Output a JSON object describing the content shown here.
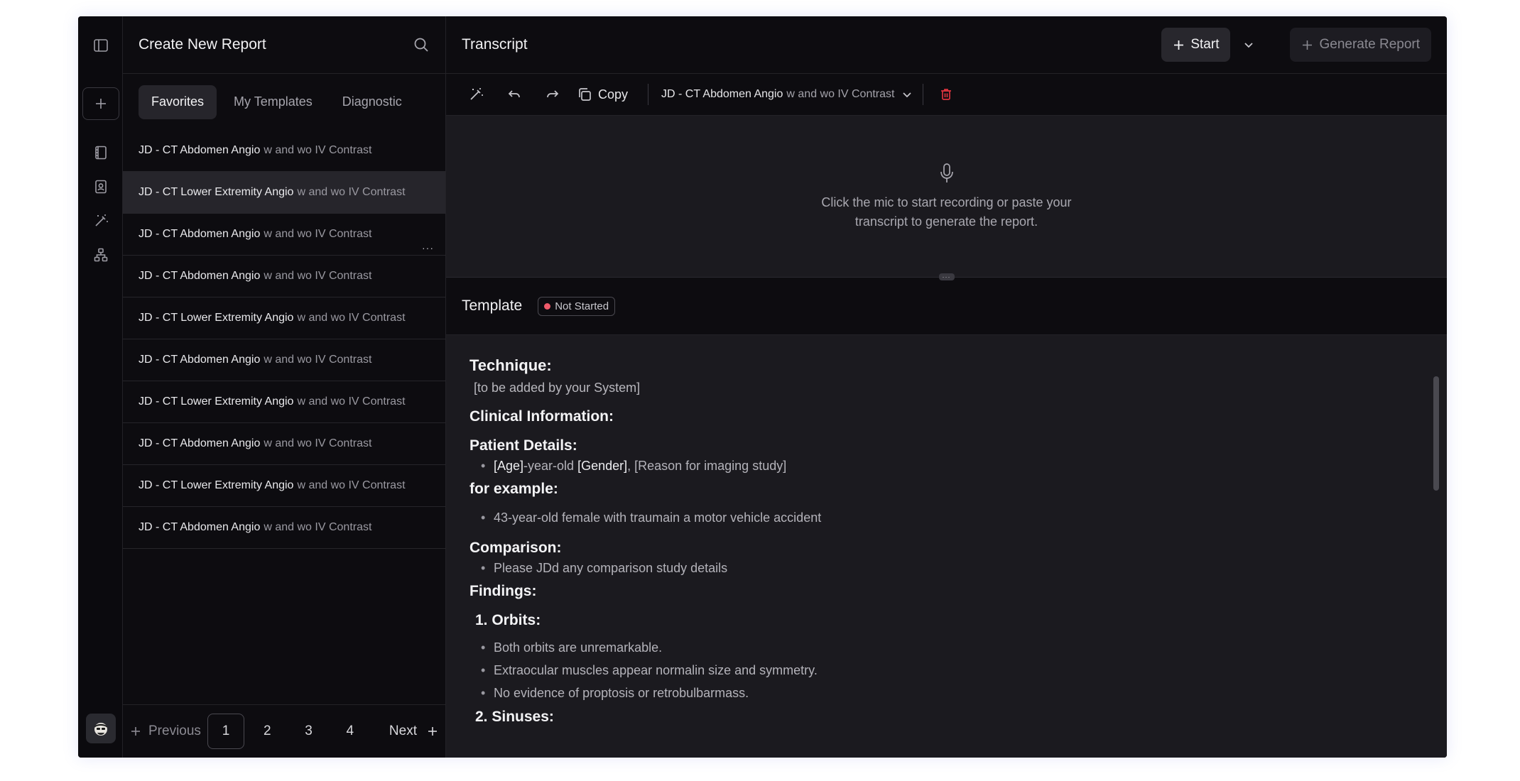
{
  "sidebar_panel": {
    "title": "Create New Report",
    "tabs": [
      {
        "label": "Favorites",
        "active": true
      },
      {
        "label": "My Templates",
        "active": false
      },
      {
        "label": "Diagnostic",
        "active": false
      }
    ],
    "templates": [
      {
        "name": "JD - CT Abdomen Angio",
        "suffix": "w and wo IV Contrast"
      },
      {
        "name": "JD - CT Lower Extremity Angio",
        "suffix": "w and wo IV Contrast"
      },
      {
        "name": "JD - CT Abdomen Angio",
        "suffix": "w and wo IV Contrast"
      },
      {
        "name": "JD - CT Abdomen Angio",
        "suffix": "w and wo IV Contrast"
      },
      {
        "name": "JD - CT Lower Extremity Angio",
        "suffix": "w and wo IV Contrast"
      },
      {
        "name": "JD - CT Abdomen Angio",
        "suffix": "w and wo IV Contrast"
      },
      {
        "name": "JD - CT Lower Extremity Angio",
        "suffix": "w and wo IV Contrast"
      },
      {
        "name": "JD - CT Abdomen Angio",
        "suffix": "w and wo IV Contrast"
      },
      {
        "name": "JD - CT Lower Extremity Angio",
        "suffix": "w and wo IV Contrast"
      },
      {
        "name": "JD - CT Abdomen Angio",
        "suffix": "w and wo IV Contrast"
      }
    ],
    "row_more": "···",
    "pagination": {
      "previous": "Previous",
      "next": "Next",
      "pages": [
        "1",
        "2",
        "3",
        "4"
      ],
      "current": "1"
    }
  },
  "transcript": {
    "title": "Transcript",
    "start_label": "Start",
    "generate_label": "Generate Report",
    "copy_label": "Copy",
    "selected_template_name": "JD - CT Abdomen Angio",
    "selected_template_suffix": "w and wo IV Contrast",
    "hint": "Click the mic to start recording or paste your transcript to generate the report.",
    "handle": "···"
  },
  "template": {
    "title": "Template",
    "status": "Not Started",
    "status_color": "#ef5a6a",
    "technique_heading": "Technique:",
    "technique_text": "[to be added by your System]",
    "clinical_heading": "Clinical Information:",
    "patient_heading": "Patient Details:",
    "patient_item": {
      "age": "[Age]",
      "mid": "-year-old ",
      "gender": "[Gender]",
      "rest": ", [Reason for imaging study]"
    },
    "example_heading": "for example:",
    "example_item": "43-year-old female with traumain a motor vehicle accident",
    "comparison_heading": "Comparison:",
    "comparison_item": "Please JDd any comparison study details",
    "findings_heading": "Findings:",
    "orbits_heading": "1. Orbits:",
    "orbits_items": [
      "Both orbits are unremarkable.",
      "Extraocular muscles appear normalin size and symmetry.",
      "No evidence of proptosis or retrobulbarmass."
    ],
    "sinuses_heading": "2. Sinuses:"
  },
  "icons": {
    "rail": [
      "sidebar-toggle-icon",
      "plus-icon",
      "film-icon",
      "contact-book-icon",
      "magic-wand-icon",
      "hierarchy-icon",
      "avatar"
    ],
    "toolbar": [
      "magic-wand-icon",
      "undo-icon",
      "redo-icon",
      "copy-icon",
      "chevron-down-icon",
      "trash-icon"
    ]
  }
}
